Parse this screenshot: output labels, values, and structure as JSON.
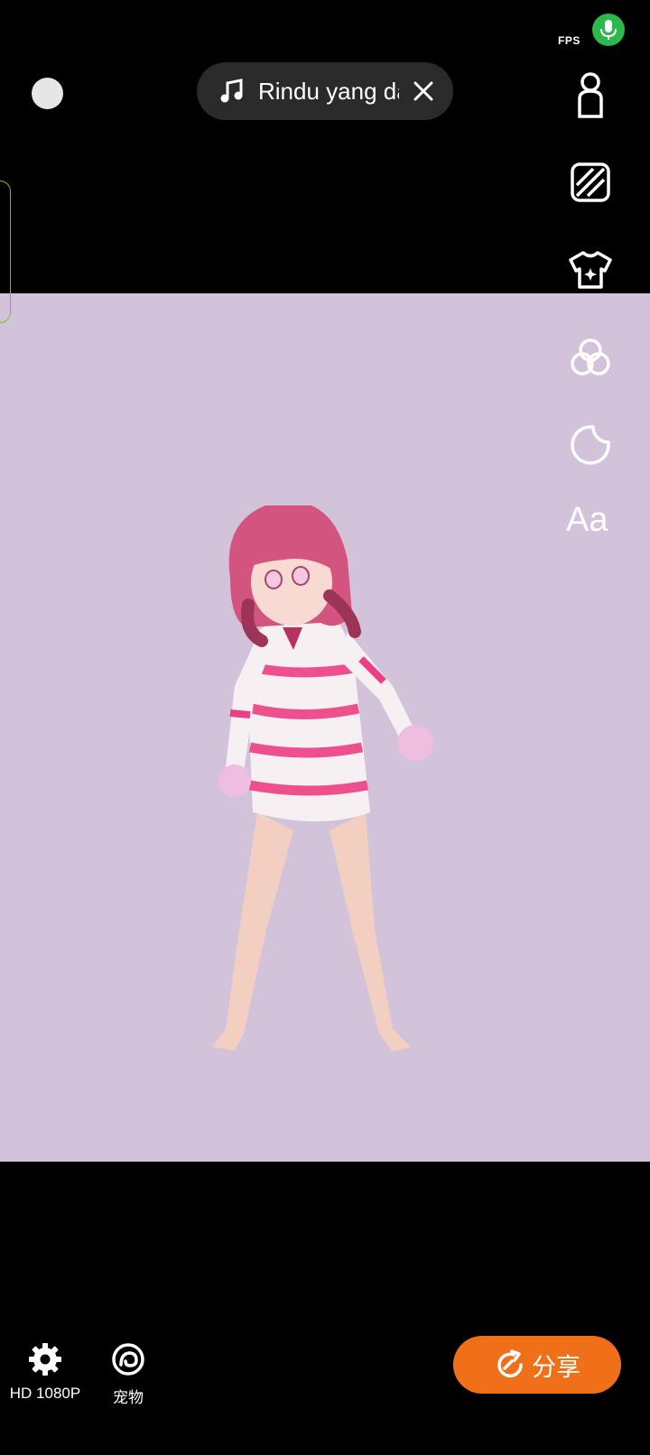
{
  "status": {
    "fps_label": "FPS"
  },
  "music": {
    "title": "Rindu yang dalam"
  },
  "toolbar": {
    "text_tool_label": "Aa"
  },
  "bottom": {
    "settings_label": "HD 1080P",
    "pet_label": "宠物",
    "share_label": "分享"
  },
  "colors": {
    "stage_background": "#d2c3da",
    "mic_active": "#2bb94e",
    "share_accent": "#f0701a",
    "side_tab_border": "#7dbb2b"
  },
  "icons": [
    "microphone-icon",
    "music-note-icon",
    "close-icon",
    "avatar-icon",
    "background-icon",
    "outfit-icon",
    "filter-icon",
    "sticker-icon",
    "text-icon",
    "gear-icon",
    "pet-icon",
    "share-icon"
  ]
}
